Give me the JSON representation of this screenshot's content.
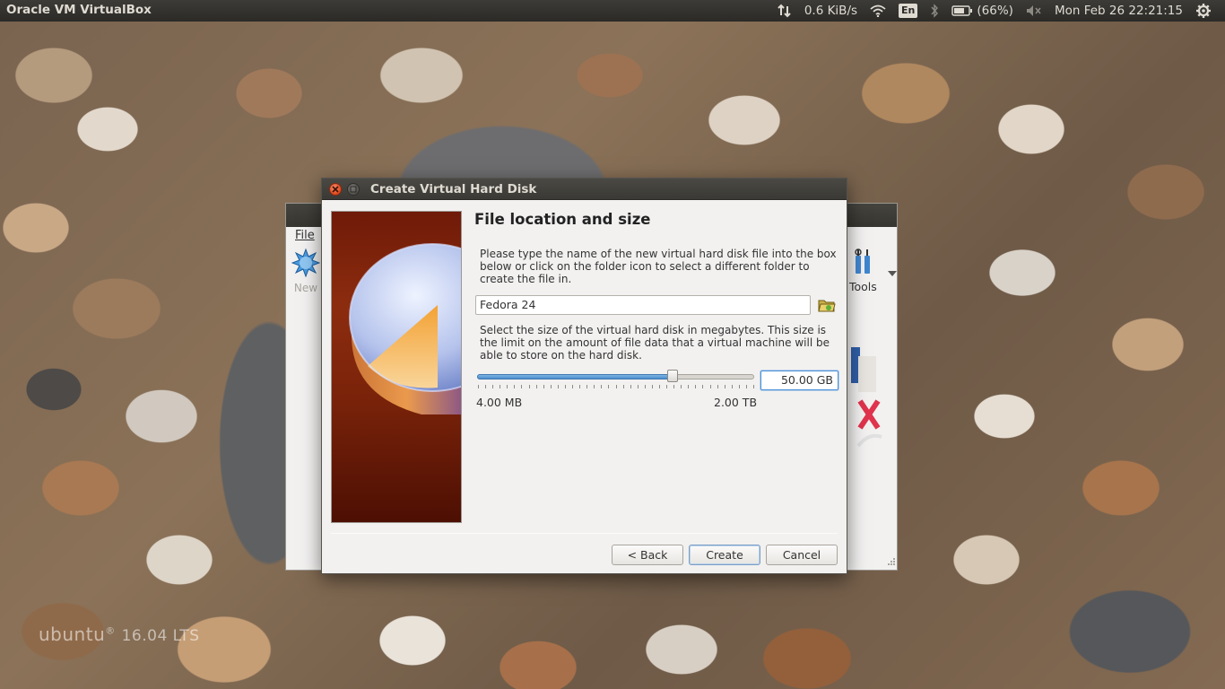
{
  "top_panel": {
    "app_title": "Oracle VM VirtualBox",
    "network_speed": "0.6 KiB/s",
    "keyboard_layout": "En",
    "battery": "(66%)",
    "datetime": "Mon Feb 26 22:21:15",
    "icons": [
      "transfer-icon",
      "wifi-icon",
      "bluetooth-icon",
      "battery-icon",
      "volume-muted-icon",
      "settings-gear-icon"
    ]
  },
  "desktop": {
    "brand": "ubuntu",
    "version": "16.04 LTS"
  },
  "manager_window": {
    "menu_file": "File",
    "new_label": "New",
    "tools_label": "Tools"
  },
  "dialog": {
    "title": "Create Virtual Hard Disk",
    "heading": "File location and size",
    "location_help": "Please type the name of the new virtual hard disk file into the box below or click on the folder icon to select a different folder to create the file in.",
    "file_name": "Fedora 24",
    "size_help": "Select the size of the virtual hard disk in megabytes. This size is the limit on the amount of file data that a virtual machine will be able to store on the hard disk.",
    "size_value": "50.00 GB",
    "slider_fraction": 0.705,
    "slider_min_label": "4.00 MB",
    "slider_max_label": "2.00 TB",
    "buttons": {
      "back": "< Back",
      "create": "Create",
      "cancel": "Cancel"
    }
  }
}
